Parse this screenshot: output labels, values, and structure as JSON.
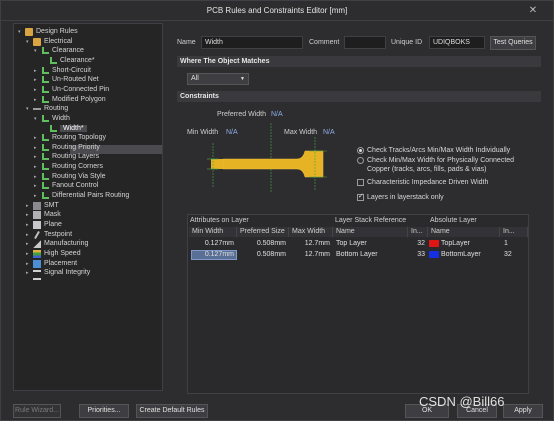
{
  "window": {
    "title": "PCB Rules and Constraints Editor [mm]"
  },
  "tree": {
    "items": [
      {
        "label": "Design Rules",
        "level": 0,
        "icon": "folder-icon",
        "arrow": "▾"
      },
      {
        "label": "Electrical",
        "level": 1,
        "icon": "folder-icon",
        "arrow": "▾"
      },
      {
        "label": "Clearance",
        "level": 2,
        "icon": "rule-icon",
        "arrow": "▾"
      },
      {
        "label": "Clearance*",
        "level": 3,
        "icon": "rule-icon",
        "arrow": ""
      },
      {
        "label": "Short-Circuit",
        "level": 2,
        "icon": "rule-icon",
        "arrow": "▸"
      },
      {
        "label": "Un-Routed Net",
        "level": 2,
        "icon": "rule-icon",
        "arrow": "▸"
      },
      {
        "label": "Un-Connected Pin",
        "level": 2,
        "icon": "rule-icon",
        "arrow": "▸"
      },
      {
        "label": "Modified Polygon",
        "level": 2,
        "icon": "rule-icon",
        "arrow": "▸"
      },
      {
        "label": "Routing",
        "level": 1,
        "icon": "routing-icon",
        "arrow": "▾"
      },
      {
        "label": "Width",
        "level": 2,
        "icon": "rule-icon",
        "arrow": "▾"
      },
      {
        "label": "Width*",
        "level": 3,
        "icon": "rule-icon",
        "arrow": "",
        "selected": true
      },
      {
        "label": "Routing Topology",
        "level": 2,
        "icon": "rule-icon",
        "arrow": "▸"
      },
      {
        "label": "Routing Priority",
        "level": 2,
        "icon": "rule-icon",
        "arrow": "▸"
      },
      {
        "label": "Routing Layers",
        "level": 2,
        "icon": "rule-icon",
        "arrow": "▸"
      },
      {
        "label": "Routing Corners",
        "level": 2,
        "icon": "rule-icon",
        "arrow": "▸"
      },
      {
        "label": "Routing Via Style",
        "level": 2,
        "icon": "rule-icon",
        "arrow": "▸"
      },
      {
        "label": "Fanout Control",
        "level": 2,
        "icon": "rule-icon",
        "arrow": "▸"
      },
      {
        "label": "Differential Pairs Routing",
        "level": 2,
        "icon": "rule-icon",
        "arrow": "▸"
      },
      {
        "label": "SMT",
        "level": 1,
        "icon": "smt-icon",
        "arrow": "▸"
      },
      {
        "label": "Mask",
        "level": 1,
        "icon": "mask-icon",
        "arrow": "▸"
      },
      {
        "label": "Plane",
        "level": 1,
        "icon": "plane-icon",
        "arrow": "▸"
      },
      {
        "label": "Testpoint",
        "level": 1,
        "icon": "testpoint-icon",
        "arrow": "▸"
      },
      {
        "label": "Manufacturing",
        "level": 1,
        "icon": "manufacturing-icon",
        "arrow": "▸"
      },
      {
        "label": "High Speed",
        "level": 1,
        "icon": "high-speed-icon",
        "arrow": "▸"
      },
      {
        "label": "Placement",
        "level": 1,
        "icon": "placement-icon",
        "arrow": "▸"
      },
      {
        "label": "Signal Integrity",
        "level": 1,
        "icon": "signal-integrity-icon",
        "arrow": "▸"
      }
    ]
  },
  "header": {
    "name_label": "Name",
    "name_value": "Width",
    "comment_label": "Comment",
    "comment_value": "",
    "uid_label": "Unique ID",
    "uid_value": "UDIQBOKS",
    "test_queries": "Test Queries"
  },
  "where": {
    "title": "Where The Object Matches",
    "selected": "All"
  },
  "constraints": {
    "title": "Constraints",
    "preferred_label": "Preferred Width",
    "preferred_value": "N/A",
    "min_label": "Min Width",
    "min_value": "N/A",
    "max_label": "Max Width",
    "max_value": "N/A",
    "options": [
      {
        "type": "radio",
        "checked": true,
        "text": "Check Tracks/Arcs Min/Max Width Individually"
      },
      {
        "type": "radio",
        "checked": false,
        "text": "Check Min/Max Width for Physically Connected"
      },
      {
        "type": "text",
        "text": "Copper (tracks, arcs, fills, pads & vias)"
      },
      {
        "type": "check",
        "checked": false,
        "text": "Characteristic Impedance Driven Width"
      },
      {
        "type": "check",
        "checked": true,
        "text": "Layers in layerstack only"
      }
    ]
  },
  "grid": {
    "groups": [
      "Attributes on Layer",
      "Layer Stack Reference",
      "Absolute Layer"
    ],
    "columns": [
      "Min Width",
      "Preferred Size",
      "Max Width",
      "Name",
      "In...",
      "Name",
      "In..."
    ],
    "rows": [
      {
        "min": "0.127mm",
        "pref": "0.508mm",
        "max": "12.7mm",
        "layer": "Top Layer",
        "idx": "32",
        "abs_name": "TopLayer",
        "abs_idx": "1",
        "color": "#e01515"
      },
      {
        "min": "0.127mm",
        "pref": "0.508mm",
        "max": "12.7mm",
        "layer": "Bottom Layer",
        "idx": "33",
        "abs_name": "BottomLayer",
        "abs_idx": "32",
        "color": "#1530e0"
      }
    ]
  },
  "footer": {
    "rule_wizard": "Rule Wizard...",
    "priorities": "Priorities...",
    "create_default": "Create Default Rules",
    "ok": "OK",
    "cancel": "Cancel",
    "apply": "Apply"
  },
  "watermark": "CSDN @Bill66",
  "colors": {
    "trace": "#e5b323",
    "accent": "#5a6f96"
  }
}
